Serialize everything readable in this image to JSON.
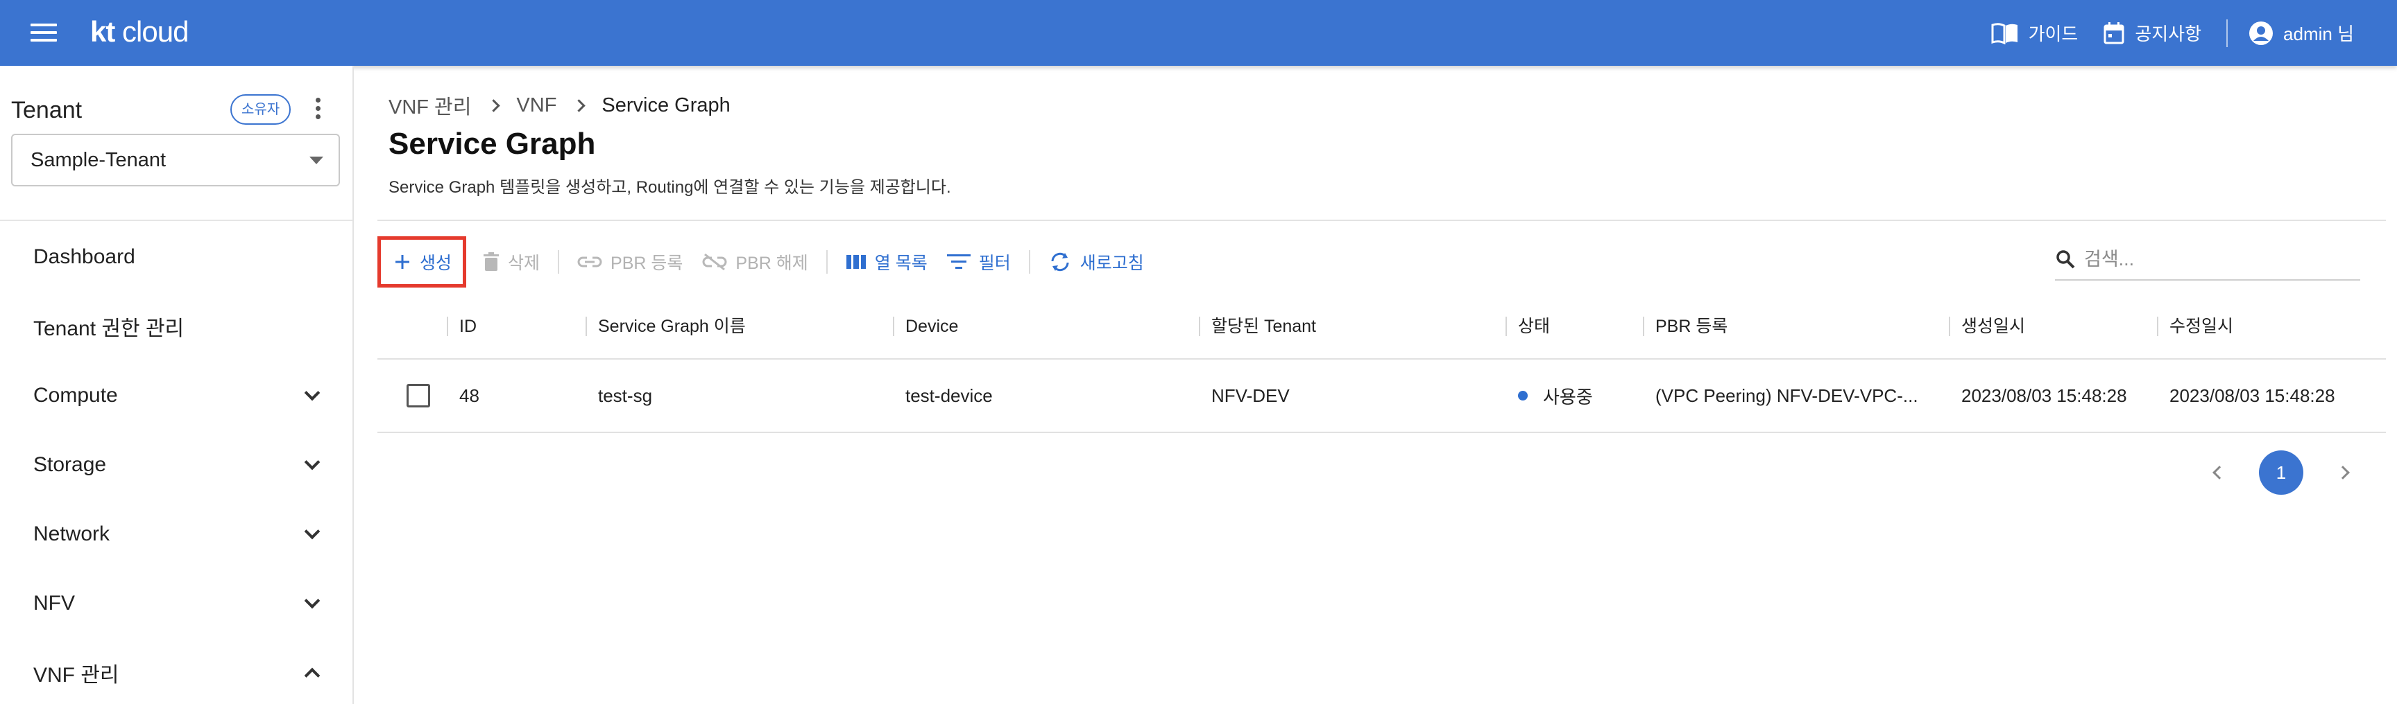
{
  "header": {
    "logo_kt": "kt",
    "logo_cloud": "cloud",
    "guide_label": "가이드",
    "notice_label": "공지사항",
    "user_label": "admin 님",
    "brand_color": "#3b74d0"
  },
  "sidebar": {
    "tenant_title": "Tenant",
    "owner_badge": "소유자",
    "tenant_selected": "Sample-Tenant",
    "items": [
      {
        "label": "Dashboard"
      },
      {
        "label": "Tenant 권한 관리"
      },
      {
        "label": "Compute",
        "expand": "down"
      },
      {
        "label": "Storage",
        "expand": "down"
      },
      {
        "label": "Network",
        "expand": "down"
      },
      {
        "label": "NFV",
        "expand": "down"
      },
      {
        "label": "VNF 관리",
        "expand": "up"
      }
    ]
  },
  "breadcrumb": [
    "VNF 관리",
    "VNF",
    "Service Graph"
  ],
  "page": {
    "title": "Service Graph",
    "description": "Service Graph 템플릿을 생성하고, Routing에 연결할 수 있는 기능을 제공합니다."
  },
  "toolbar": {
    "create": "생성",
    "delete": "삭제",
    "pbr_register": "PBR 등록",
    "pbr_release": "PBR 해제",
    "columns": "열 목록",
    "filter": "필터",
    "refresh": "새로고침",
    "highlight_color": "#e53a2d"
  },
  "search": {
    "placeholder": "검색..."
  },
  "table": {
    "headers": [
      "ID",
      "Service Graph 이름",
      "Device",
      "할당된 Tenant",
      "상태",
      "PBR 등록",
      "생성일시",
      "수정일시"
    ],
    "rows": [
      {
        "id": "48",
        "name": "test-sg",
        "device": "test-device",
        "tenant": "NFV-DEV",
        "status": "사용중",
        "pbr": "(VPC Peering) NFV-DEV-VPC-...",
        "created": "2023/08/03 15:48:28",
        "updated": "2023/08/03 15:48:28"
      }
    ]
  },
  "pagination": {
    "current": "1"
  }
}
